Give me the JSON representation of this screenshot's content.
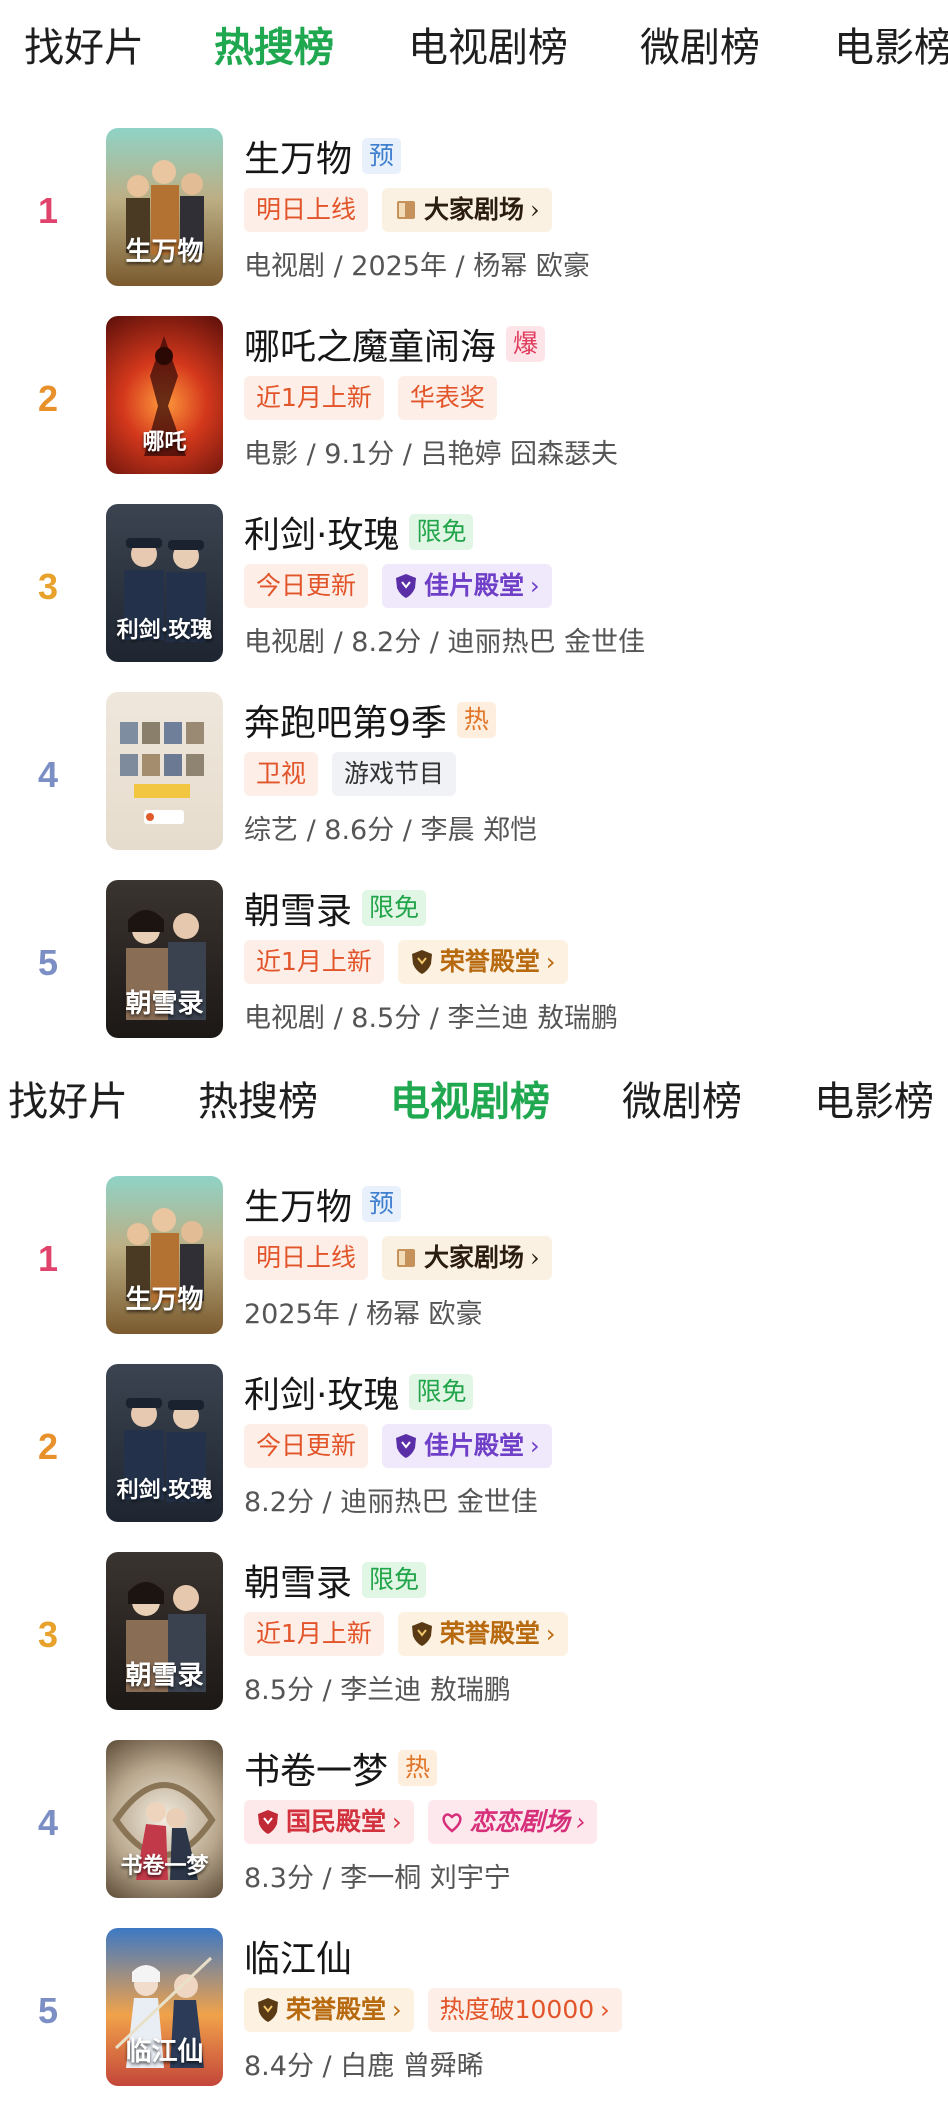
{
  "sections": [
    {
      "tabs": [
        {
          "label": "找好片",
          "active": false
        },
        {
          "label": "热搜榜",
          "active": true
        },
        {
          "label": "电视剧榜",
          "active": false
        },
        {
          "label": "微剧榜",
          "active": false
        },
        {
          "label": "电影榜",
          "active": false
        }
      ],
      "items": [
        {
          "rank": "1",
          "title": "生万物",
          "badge": "预",
          "tags": [
            "明日上线",
            "大家剧场"
          ],
          "meta": "电视剧 / 2025年 / 杨幂 欧豪",
          "poster_caption": "生万物"
        },
        {
          "rank": "2",
          "title": "哪吒之魔童闹海",
          "badge": "爆",
          "tags": [
            "近1月上新",
            "华表奖"
          ],
          "meta": "电影 / 9.1分 / 吕艳婷 囧森瑟夫",
          "poster_caption": "哪吒"
        },
        {
          "rank": "3",
          "title": "利剑·玫瑰",
          "badge": "限免",
          "tags": [
            "今日更新",
            "佳片殿堂"
          ],
          "meta": "电视剧 / 8.2分 / 迪丽热巴 金世佳",
          "poster_caption": "利剑·玫瑰"
        },
        {
          "rank": "4",
          "title": "奔跑吧第9季",
          "badge": "热",
          "tags": [
            "卫视",
            "游戏节目"
          ],
          "meta": "综艺 / 8.6分 / 李晨 郑恺",
          "poster_caption": ""
        },
        {
          "rank": "5",
          "title": "朝雪录",
          "badge": "限免",
          "tags": [
            "近1月上新",
            "荣誉殿堂"
          ],
          "meta": "电视剧 / 8.5分 / 李兰迪 敖瑞鹏",
          "poster_caption": "朝雪录"
        }
      ]
    },
    {
      "tabs": [
        {
          "label": "找好片",
          "active": false
        },
        {
          "label": "热搜榜",
          "active": false
        },
        {
          "label": "电视剧榜",
          "active": true
        },
        {
          "label": "微剧榜",
          "active": false
        },
        {
          "label": "电影榜",
          "active": false
        }
      ],
      "items": [
        {
          "rank": "1",
          "title": "生万物",
          "badge": "预",
          "tags": [
            "明日上线",
            "大家剧场"
          ],
          "meta": "2025年 / 杨幂 欧豪",
          "poster_caption": "生万物"
        },
        {
          "rank": "2",
          "title": "利剑·玫瑰",
          "badge": "限免",
          "tags": [
            "今日更新",
            "佳片殿堂"
          ],
          "meta": "8.2分 / 迪丽热巴 金世佳",
          "poster_caption": "利剑·玫瑰"
        },
        {
          "rank": "3",
          "title": "朝雪录",
          "badge": "限免",
          "tags": [
            "近1月上新",
            "荣誉殿堂"
          ],
          "meta": "8.5分 / 李兰迪 敖瑞鹏",
          "poster_caption": "朝雪录"
        },
        {
          "rank": "4",
          "title": "书卷一梦",
          "badge": "热",
          "tags": [
            "国民殿堂",
            "恋恋剧场"
          ],
          "meta": "8.3分 / 李一桐 刘宇宁",
          "poster_caption": "书卷一梦"
        },
        {
          "rank": "5",
          "title": "临江仙",
          "badge": "",
          "tags": [
            "荣誉殿堂",
            "热度破10000"
          ],
          "meta": "8.4分 / 白鹿 曾舜晞",
          "poster_caption": "临江仙"
        }
      ]
    }
  ],
  "colors": {
    "active_tab": "#1fa84f",
    "rank1": "#e0436b",
    "rank2": "#e8912b",
    "rank3": "#e8a22b",
    "rank4": "#7b8fc4",
    "rank5": "#7b8fc4"
  }
}
